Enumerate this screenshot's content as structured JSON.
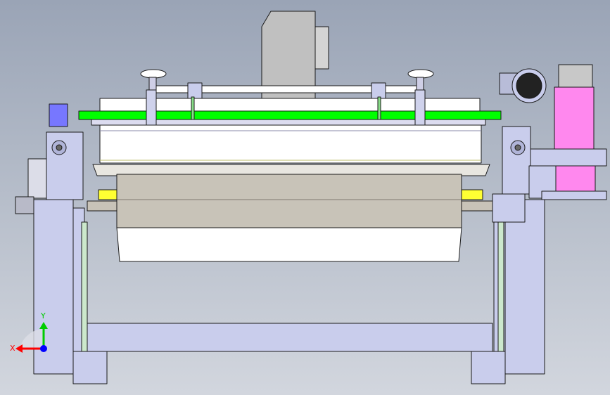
{
  "window": {
    "viewport_label": "",
    "background_top": "#9aa4b6",
    "background_bottom": "#d2d6de"
  },
  "colors": {
    "frame": "#c9cdec",
    "roller": "#ffffff",
    "belt": "#00ff00",
    "motor_pink": "#ff88ee",
    "yellow_block": "#ffff33",
    "tray": "#c8c3b8",
    "edge": "#1a1a1a"
  },
  "triad": {
    "x_label": "X",
    "y_label": "Y",
    "x_color": "#ff0000",
    "y_color": "#00cc00",
    "z_color": "#0000ff"
  }
}
